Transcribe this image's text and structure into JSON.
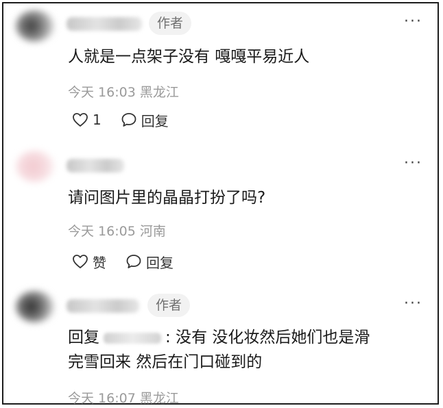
{
  "comments": [
    {
      "author_tag": "作者",
      "more": "···",
      "text": "人就是一点架子没有 嘎嘎平易近人",
      "time": "今天 16:03",
      "location": "黑龙江",
      "like_label": "1",
      "reply_label": "回复"
    },
    {
      "more": "···",
      "text": "请问图片里的晶晶打扮了吗?",
      "time": "今天 16:05",
      "location": "河南",
      "like_label": "赞",
      "reply_label": "回复"
    },
    {
      "author_tag": "作者",
      "more": "···",
      "reply_prefix": "回复",
      "reply_colon": ":",
      "text_line1": "没有 没化妆然后她们也是滑",
      "text_line2": "完雪回来 然后在门口碰到的",
      "time": "今天 16:07",
      "location": "黑龙江"
    }
  ],
  "icons": {
    "like": "heart-outline-icon",
    "reply": "speech-bubble-icon",
    "more": "more-dots-icon"
  }
}
